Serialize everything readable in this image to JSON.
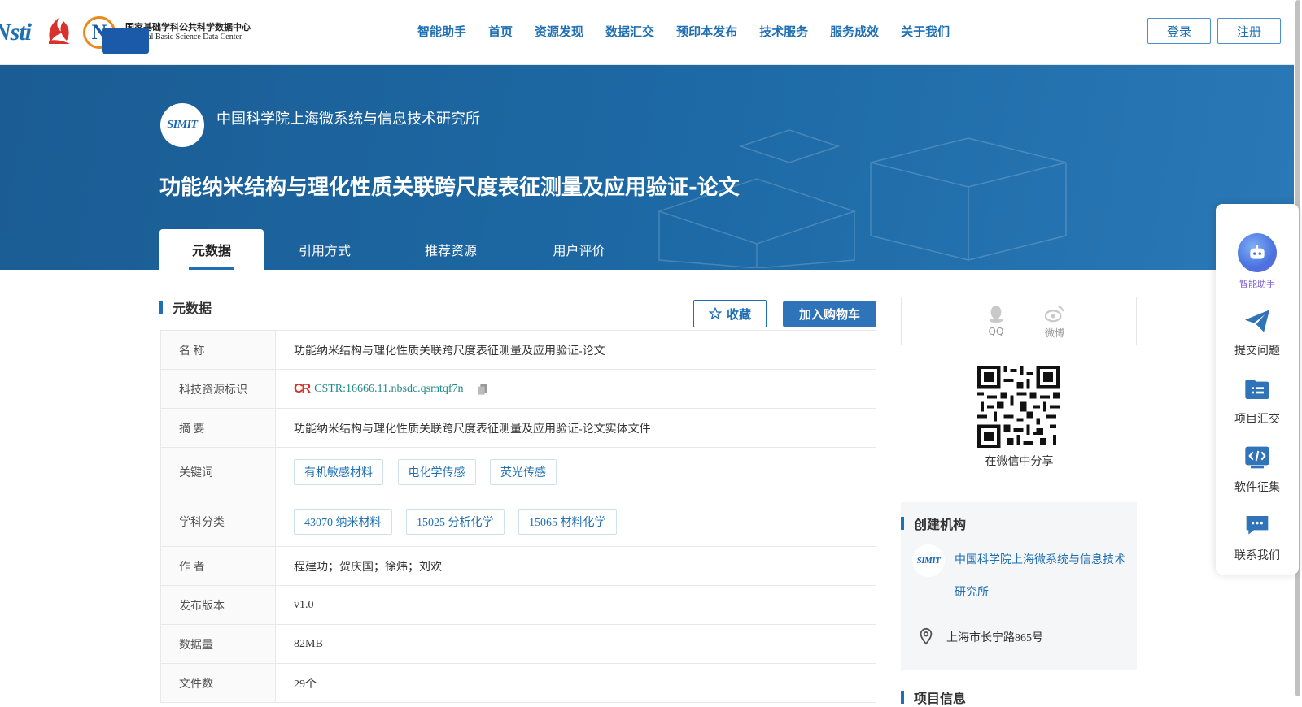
{
  "header": {
    "logo_nsti": "Nsti",
    "logo_nsdc_tag": "SDC",
    "logo_nsdc_cn": "国家基础学科公共科学数据中心",
    "logo_nsdc_en": "National Basic Science Data Center",
    "nav": [
      "智能助手",
      "首页",
      "资源发现",
      "数据汇交",
      "预印本发布",
      "技术服务",
      "服务成效",
      "关于我们"
    ],
    "login": "登录",
    "register": "注册"
  },
  "banner": {
    "org_name": "中国科学院上海微系统与信息技术研究所",
    "org_logo_text": "SIMIT",
    "title": "功能纳米结构与理化性质关联跨尺度表征测量及应用验证-论文",
    "tabs": [
      "元数据",
      "引用方式",
      "推荐资源",
      "用户评价"
    ]
  },
  "metadata": {
    "section_title": "元数据",
    "favorite": "收藏",
    "add_cart": "加入购物车",
    "rows": {
      "name_k": "名  称",
      "name_v": "功能纳米结构与理化性质关联跨尺度表征测量及应用验证-论文",
      "cstr_k": "科技资源标识",
      "cstr_logo": "CR",
      "cstr_v": "CSTR:16666.11.nbsdc.qsmtqf7n",
      "abstract_k": "摘  要",
      "abstract_v": "功能纳米结构与理化性质关联跨尺度表征测量及应用验证-论文实体文件",
      "keywords_k": "关键词",
      "keywords": [
        "有机敏感材料",
        "电化学传感",
        "荧光传感"
      ],
      "subjects_k": "学科分类",
      "subjects": [
        "43070 纳米材料",
        "15025 分析化学",
        "15065 材料化学"
      ],
      "authors_k": "作  者",
      "authors_v": "程建功；贺庆国；徐炜；刘欢",
      "version_k": "发布版本",
      "version_v": "v1.0",
      "size_k": "数据量",
      "size_v": "82MB",
      "files_k": "文件数",
      "files_v": "29个"
    }
  },
  "side": {
    "share_qq": "QQ",
    "share_weibo": "微博",
    "qr_caption": "在微信中分享",
    "creator_title": "创建机构",
    "creator_org": "中国科学院上海微系统与信息技术研究所",
    "creator_logo_text": "SIMIT",
    "creator_addr": "上海市长宁路865号",
    "project_title": "项目信息"
  },
  "float_bar": {
    "assistant": "智能助手",
    "submit": "提交问题",
    "project": "项目汇交",
    "software": "软件征集",
    "contact": "联系我们"
  },
  "colors": {
    "brand": "#1f6fb4",
    "banner": "#1d6aa6",
    "accent_red": "#d7322b"
  }
}
